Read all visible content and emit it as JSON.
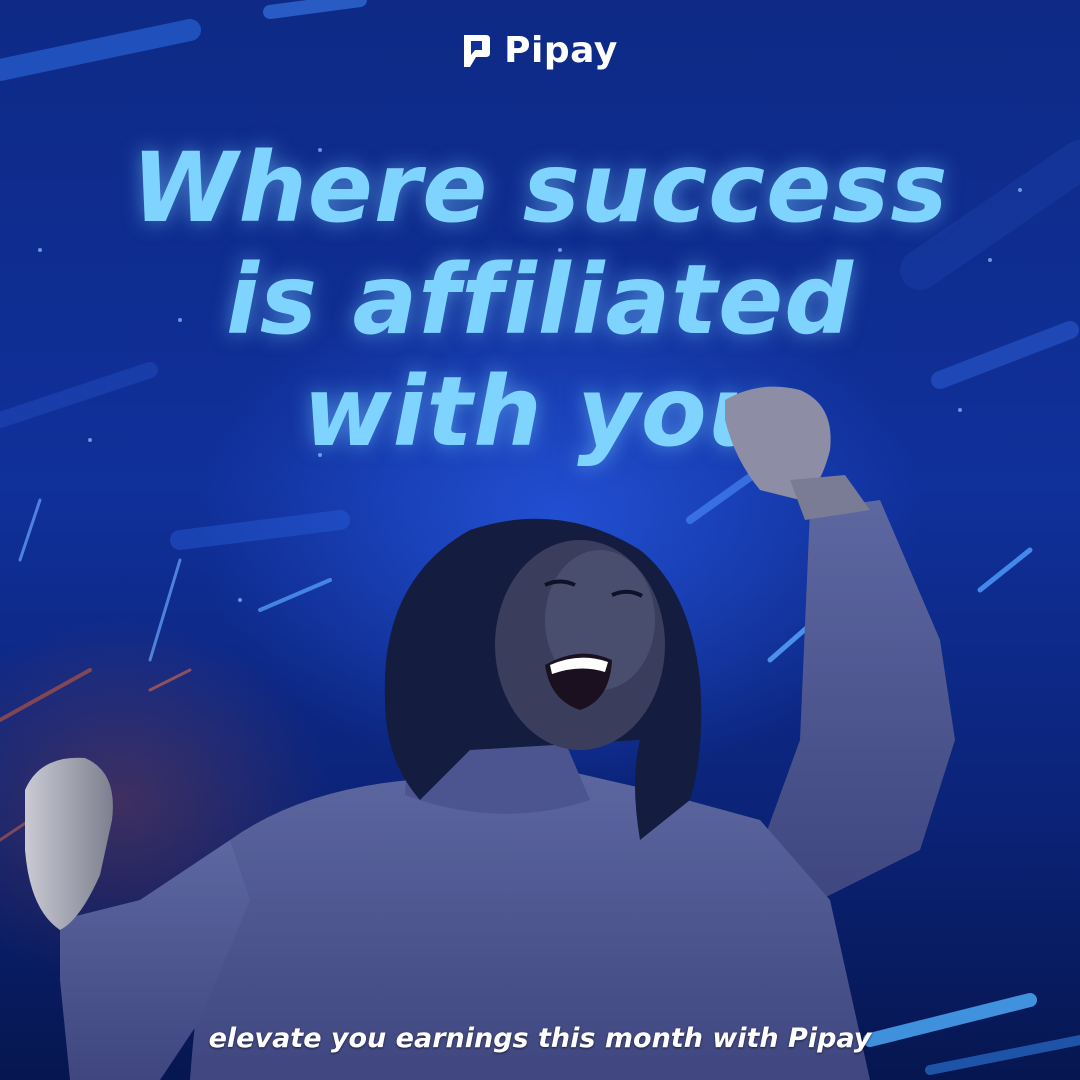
{
  "brand": {
    "name": "Pipay",
    "icon": "pipay-logo-icon"
  },
  "headline": {
    "lines": [
      "Where success",
      "is affiliated",
      "with you"
    ]
  },
  "photo": {
    "description_icon": "celebrating-woman-photo"
  },
  "tagline": "elevate you earnings this month with Pipay",
  "colors": {
    "background": "#10309a",
    "headline": "#7fd4ff",
    "text": "#ffffff"
  }
}
